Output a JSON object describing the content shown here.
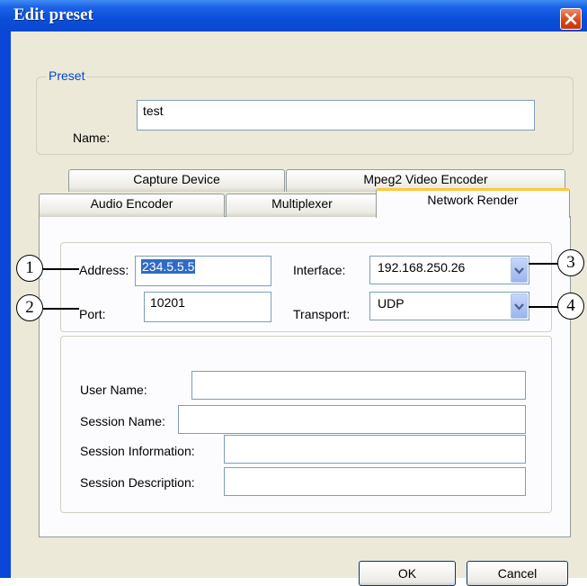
{
  "window": {
    "title": "Edit preset"
  },
  "preset": {
    "legend": "Preset",
    "name_label": "Name:",
    "name_value": "test"
  },
  "tabs": {
    "row1": [
      "Capture Device",
      "Mpeg2 Video Encoder"
    ],
    "row2": [
      "Audio Encoder",
      "Multiplexer",
      "Network Render"
    ],
    "active": "Network Render"
  },
  "network": {
    "address_label": "Address:",
    "address_value": "234.5.5.5",
    "port_label": "Port:",
    "port_value": "10201",
    "interface_label": "Interface:",
    "interface_value": "192.168.250.26",
    "transport_label": "Transport:",
    "transport_value": "UDP"
  },
  "session": {
    "user_name_label": "User Name:",
    "session_name_label": "Session Name:",
    "session_info_label": "Session Information:",
    "session_desc_label": "Session Description:",
    "user_name_value": "",
    "session_name_value": "",
    "session_info_value": "",
    "session_desc_value": ""
  },
  "buttons": {
    "ok": "OK",
    "cancel": "Cancel"
  },
  "callouts": [
    "1",
    "2",
    "3",
    "4"
  ],
  "colors": {
    "titlebar": "#0a4fd8",
    "dialog_bg": "#ece9d8",
    "group_legend": "#0046d5",
    "active_tab_accent": "#ffc83c",
    "selection": "#316ac5",
    "close_button": "#d84a1e"
  },
  "icons": {
    "close": "close-icon",
    "combo_arrow": "chevron-down-icon"
  }
}
